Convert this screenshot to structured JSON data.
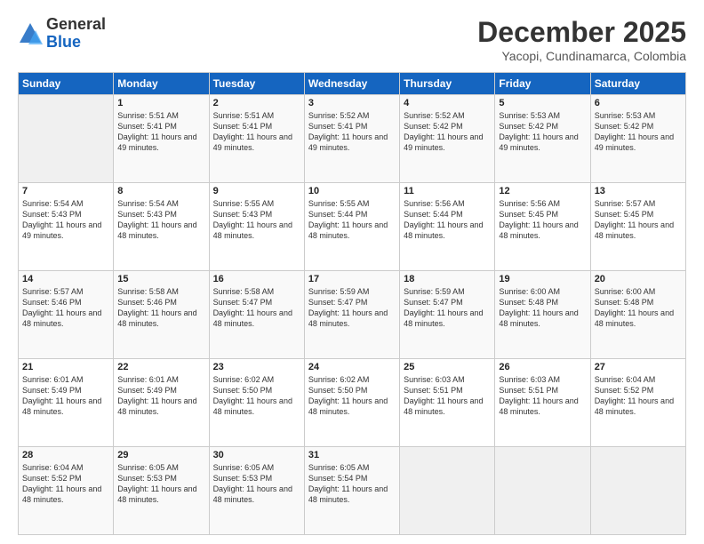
{
  "logo": {
    "general": "General",
    "blue": "Blue"
  },
  "title": "December 2025",
  "location": "Yacopi, Cundinamarca, Colombia",
  "days_header": [
    "Sunday",
    "Monday",
    "Tuesday",
    "Wednesday",
    "Thursday",
    "Friday",
    "Saturday"
  ],
  "weeks": [
    [
      {
        "day": "",
        "sunrise": "",
        "sunset": "",
        "daylight": ""
      },
      {
        "day": "1",
        "sunrise": "Sunrise: 5:51 AM",
        "sunset": "Sunset: 5:41 PM",
        "daylight": "Daylight: 11 hours and 49 minutes."
      },
      {
        "day": "2",
        "sunrise": "Sunrise: 5:51 AM",
        "sunset": "Sunset: 5:41 PM",
        "daylight": "Daylight: 11 hours and 49 minutes."
      },
      {
        "day": "3",
        "sunrise": "Sunrise: 5:52 AM",
        "sunset": "Sunset: 5:41 PM",
        "daylight": "Daylight: 11 hours and 49 minutes."
      },
      {
        "day": "4",
        "sunrise": "Sunrise: 5:52 AM",
        "sunset": "Sunset: 5:42 PM",
        "daylight": "Daylight: 11 hours and 49 minutes."
      },
      {
        "day": "5",
        "sunrise": "Sunrise: 5:53 AM",
        "sunset": "Sunset: 5:42 PM",
        "daylight": "Daylight: 11 hours and 49 minutes."
      },
      {
        "day": "6",
        "sunrise": "Sunrise: 5:53 AM",
        "sunset": "Sunset: 5:42 PM",
        "daylight": "Daylight: 11 hours and 49 minutes."
      }
    ],
    [
      {
        "day": "7",
        "sunrise": "Sunrise: 5:54 AM",
        "sunset": "Sunset: 5:43 PM",
        "daylight": "Daylight: 11 hours and 49 minutes."
      },
      {
        "day": "8",
        "sunrise": "Sunrise: 5:54 AM",
        "sunset": "Sunset: 5:43 PM",
        "daylight": "Daylight: 11 hours and 48 minutes."
      },
      {
        "day": "9",
        "sunrise": "Sunrise: 5:55 AM",
        "sunset": "Sunset: 5:43 PM",
        "daylight": "Daylight: 11 hours and 48 minutes."
      },
      {
        "day": "10",
        "sunrise": "Sunrise: 5:55 AM",
        "sunset": "Sunset: 5:44 PM",
        "daylight": "Daylight: 11 hours and 48 minutes."
      },
      {
        "day": "11",
        "sunrise": "Sunrise: 5:56 AM",
        "sunset": "Sunset: 5:44 PM",
        "daylight": "Daylight: 11 hours and 48 minutes."
      },
      {
        "day": "12",
        "sunrise": "Sunrise: 5:56 AM",
        "sunset": "Sunset: 5:45 PM",
        "daylight": "Daylight: 11 hours and 48 minutes."
      },
      {
        "day": "13",
        "sunrise": "Sunrise: 5:57 AM",
        "sunset": "Sunset: 5:45 PM",
        "daylight": "Daylight: 11 hours and 48 minutes."
      }
    ],
    [
      {
        "day": "14",
        "sunrise": "Sunrise: 5:57 AM",
        "sunset": "Sunset: 5:46 PM",
        "daylight": "Daylight: 11 hours and 48 minutes."
      },
      {
        "day": "15",
        "sunrise": "Sunrise: 5:58 AM",
        "sunset": "Sunset: 5:46 PM",
        "daylight": "Daylight: 11 hours and 48 minutes."
      },
      {
        "day": "16",
        "sunrise": "Sunrise: 5:58 AM",
        "sunset": "Sunset: 5:47 PM",
        "daylight": "Daylight: 11 hours and 48 minutes."
      },
      {
        "day": "17",
        "sunrise": "Sunrise: 5:59 AM",
        "sunset": "Sunset: 5:47 PM",
        "daylight": "Daylight: 11 hours and 48 minutes."
      },
      {
        "day": "18",
        "sunrise": "Sunrise: 5:59 AM",
        "sunset": "Sunset: 5:47 PM",
        "daylight": "Daylight: 11 hours and 48 minutes."
      },
      {
        "day": "19",
        "sunrise": "Sunrise: 6:00 AM",
        "sunset": "Sunset: 5:48 PM",
        "daylight": "Daylight: 11 hours and 48 minutes."
      },
      {
        "day": "20",
        "sunrise": "Sunrise: 6:00 AM",
        "sunset": "Sunset: 5:48 PM",
        "daylight": "Daylight: 11 hours and 48 minutes."
      }
    ],
    [
      {
        "day": "21",
        "sunrise": "Sunrise: 6:01 AM",
        "sunset": "Sunset: 5:49 PM",
        "daylight": "Daylight: 11 hours and 48 minutes."
      },
      {
        "day": "22",
        "sunrise": "Sunrise: 6:01 AM",
        "sunset": "Sunset: 5:49 PM",
        "daylight": "Daylight: 11 hours and 48 minutes."
      },
      {
        "day": "23",
        "sunrise": "Sunrise: 6:02 AM",
        "sunset": "Sunset: 5:50 PM",
        "daylight": "Daylight: 11 hours and 48 minutes."
      },
      {
        "day": "24",
        "sunrise": "Sunrise: 6:02 AM",
        "sunset": "Sunset: 5:50 PM",
        "daylight": "Daylight: 11 hours and 48 minutes."
      },
      {
        "day": "25",
        "sunrise": "Sunrise: 6:03 AM",
        "sunset": "Sunset: 5:51 PM",
        "daylight": "Daylight: 11 hours and 48 minutes."
      },
      {
        "day": "26",
        "sunrise": "Sunrise: 6:03 AM",
        "sunset": "Sunset: 5:51 PM",
        "daylight": "Daylight: 11 hours and 48 minutes."
      },
      {
        "day": "27",
        "sunrise": "Sunrise: 6:04 AM",
        "sunset": "Sunset: 5:52 PM",
        "daylight": "Daylight: 11 hours and 48 minutes."
      }
    ],
    [
      {
        "day": "28",
        "sunrise": "Sunrise: 6:04 AM",
        "sunset": "Sunset: 5:52 PM",
        "daylight": "Daylight: 11 hours and 48 minutes."
      },
      {
        "day": "29",
        "sunrise": "Sunrise: 6:05 AM",
        "sunset": "Sunset: 5:53 PM",
        "daylight": "Daylight: 11 hours and 48 minutes."
      },
      {
        "day": "30",
        "sunrise": "Sunrise: 6:05 AM",
        "sunset": "Sunset: 5:53 PM",
        "daylight": "Daylight: 11 hours and 48 minutes."
      },
      {
        "day": "31",
        "sunrise": "Sunrise: 6:05 AM",
        "sunset": "Sunset: 5:54 PM",
        "daylight": "Daylight: 11 hours and 48 minutes."
      },
      {
        "day": "",
        "sunrise": "",
        "sunset": "",
        "daylight": ""
      },
      {
        "day": "",
        "sunrise": "",
        "sunset": "",
        "daylight": ""
      },
      {
        "day": "",
        "sunrise": "",
        "sunset": "",
        "daylight": ""
      }
    ]
  ]
}
